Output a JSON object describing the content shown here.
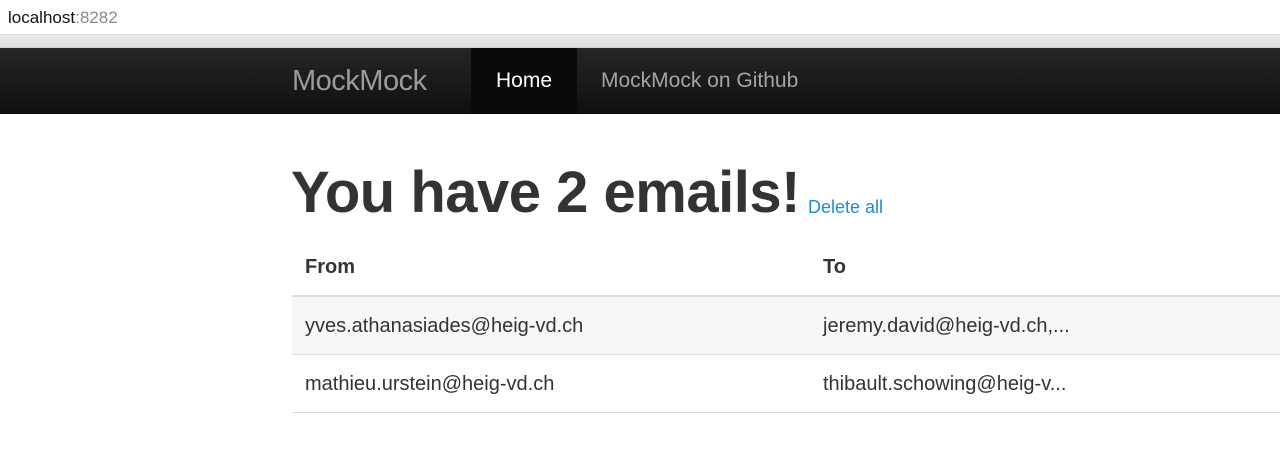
{
  "browser": {
    "host": "localhost",
    "port": ":8282"
  },
  "navbar": {
    "brand": "MockMock",
    "home_label": "Home",
    "github_label": "MockMock on Github"
  },
  "main": {
    "heading": "You have 2 emails!",
    "delete_all_label": "Delete all",
    "table": {
      "columns": [
        "From",
        "To"
      ],
      "rows": [
        [
          "yves.athanasiades@heig-vd.ch",
          "jeremy.david@heig-vd.ch,..."
        ],
        [
          "mathieu.urstein@heig-vd.ch",
          "thibault.schowing@heig-v..."
        ]
      ]
    }
  },
  "colors": {
    "navbar_bg": "#111111",
    "link": "#1f8dd6",
    "text": "#333333",
    "row_stripe": "#f7f7f7"
  }
}
